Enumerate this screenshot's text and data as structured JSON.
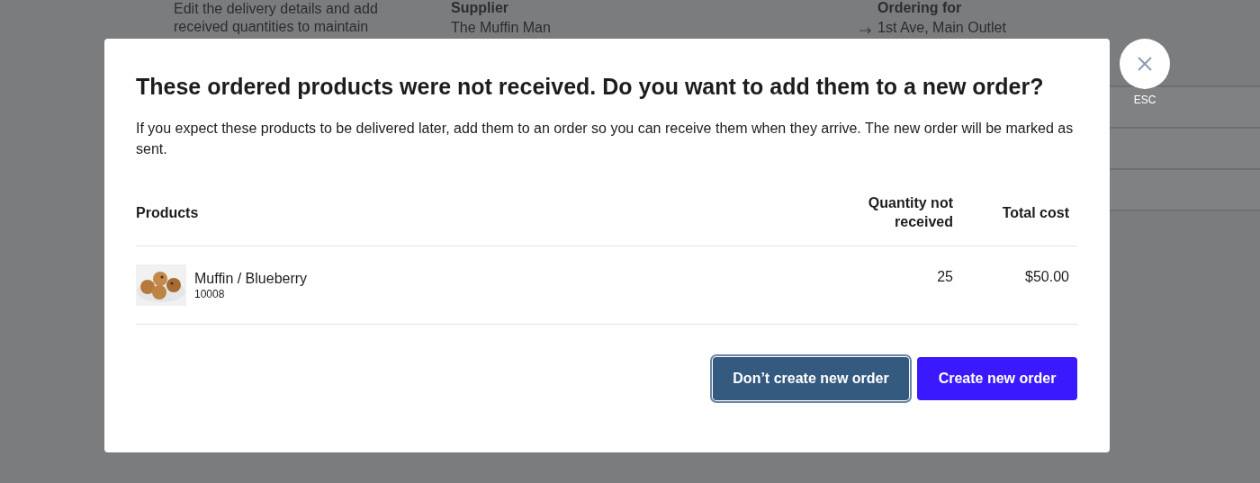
{
  "background_page": {
    "intro": "Edit the delivery details and add received quantities to maintain",
    "supplier_label": "Supplier",
    "supplier": "The Muffin Man",
    "ordering_for_label": "Ordering for",
    "ordering_for": "1st Ave, Main Outlet"
  },
  "close_button": {
    "caption": "ESC"
  },
  "dialog": {
    "title": "These ordered products were not received. Do you want to add them to a new order?",
    "message": "If you expect these products to be delivered later, add them to an order so you can receive them when they arrive. The new order will be marked as sent.",
    "table": {
      "columns": [
        "Products",
        "Quantity not received",
        "Total cost"
      ],
      "rows": [
        {
          "name": "Muffin / Blueberry",
          "sku": "10008",
          "quantity": "25",
          "total": "$50.00"
        }
      ]
    },
    "buttons": [
      {
        "label": "Don’t create new order",
        "kind": "secondary",
        "focused": true
      },
      {
        "label": "Create new order",
        "kind": "primary",
        "focused": false
      }
    ]
  }
}
